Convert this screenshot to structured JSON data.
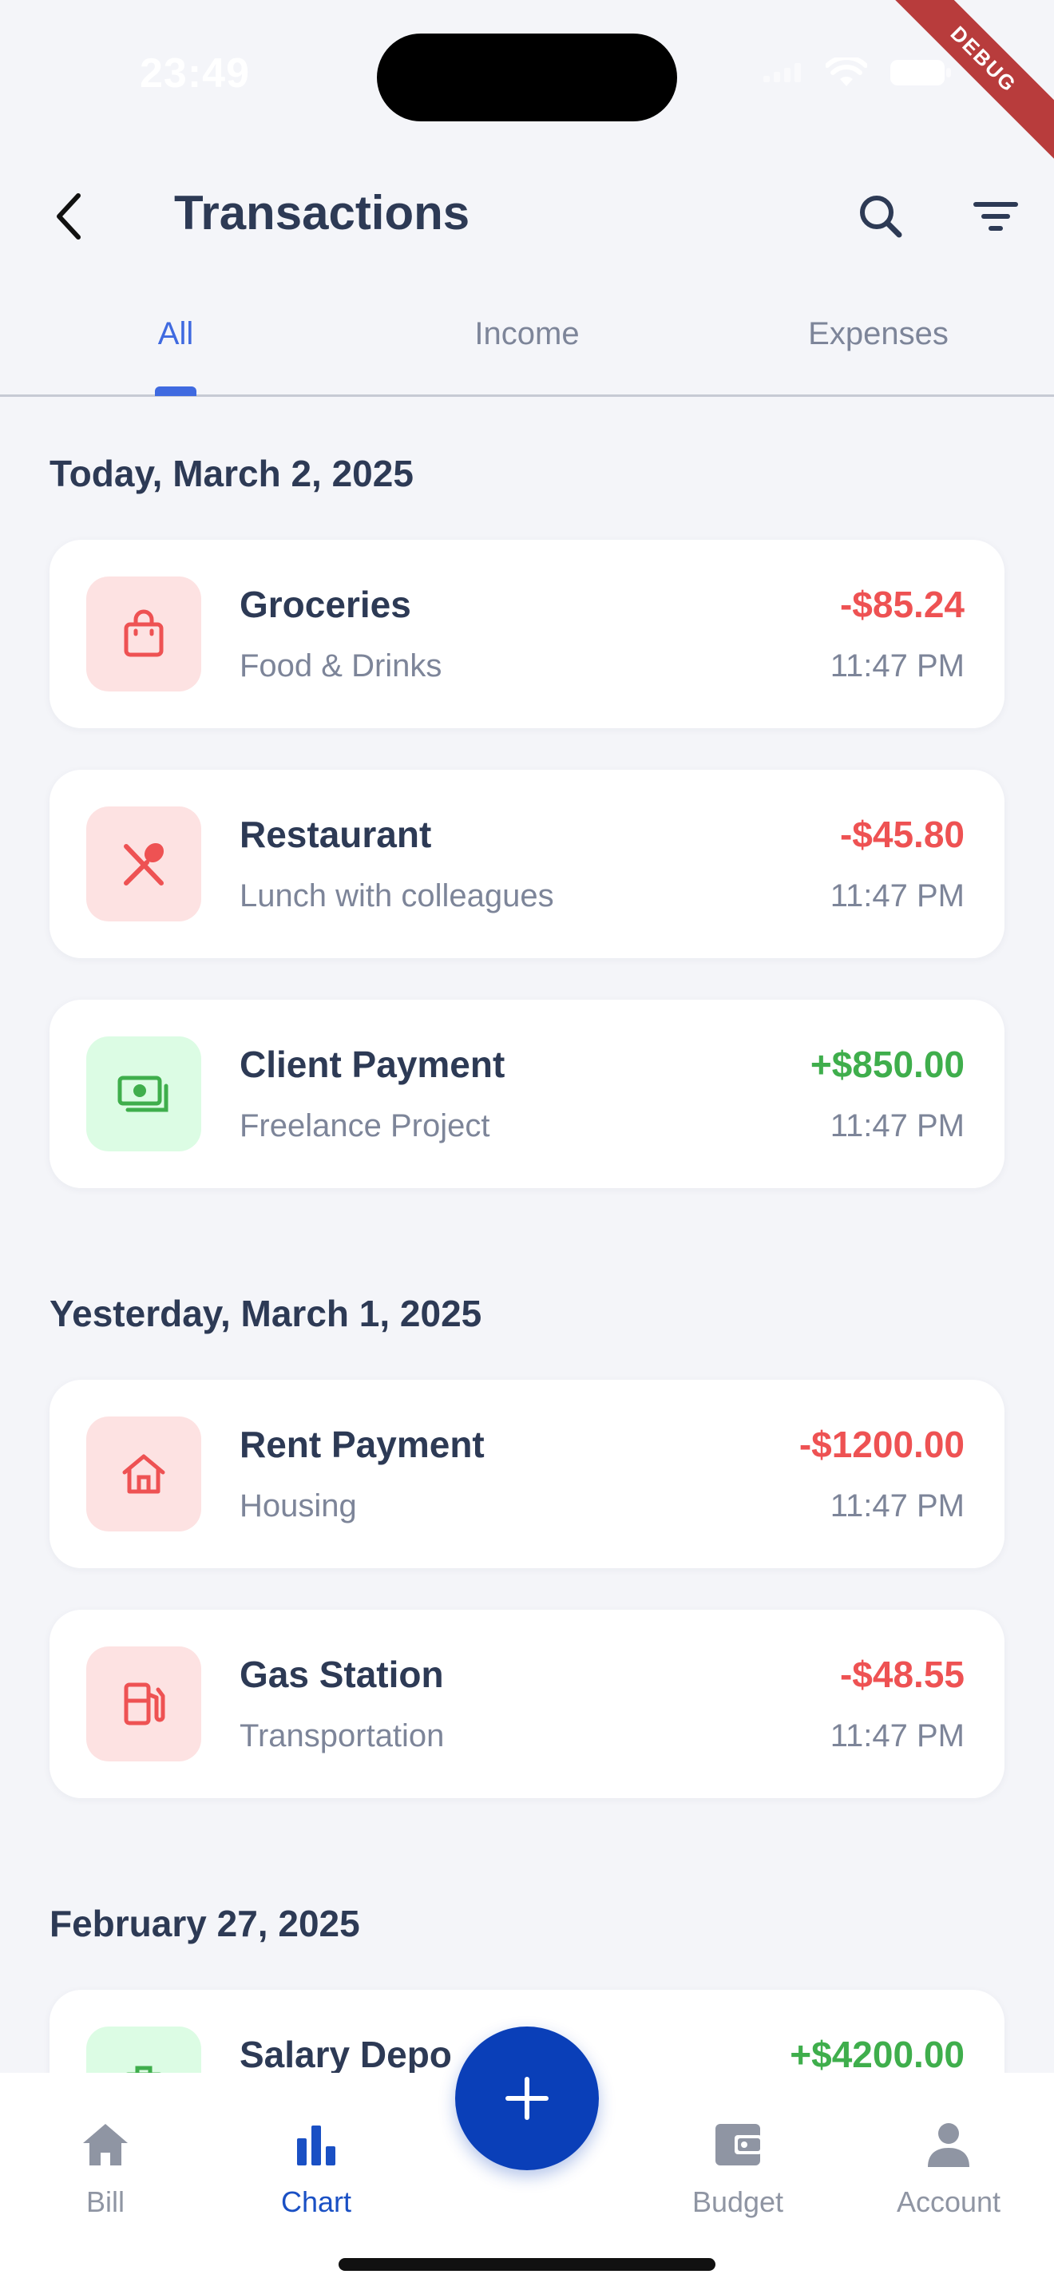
{
  "status_bar": {
    "time": "23:49",
    "debug_label": "DEBUG"
  },
  "header": {
    "title": "Transactions"
  },
  "tabs": [
    {
      "label": "All",
      "active": true
    },
    {
      "label": "Income",
      "active": false
    },
    {
      "label": "Expenses",
      "active": false
    }
  ],
  "sections": [
    {
      "title": "Today, March 2, 2025",
      "transactions": [
        {
          "title": "Groceries",
          "subtitle": "Food & Drinks",
          "amount": "-$85.24",
          "time": "11:47 PM",
          "icon": "shopping-bag-icon",
          "type": "expense"
        },
        {
          "title": "Restaurant",
          "subtitle": "Lunch with colleagues",
          "amount": "-$45.80",
          "time": "11:47 PM",
          "icon": "utensils-icon",
          "type": "expense"
        },
        {
          "title": "Client Payment",
          "subtitle": "Freelance Project",
          "amount": "+$850.00",
          "time": "11:47 PM",
          "icon": "cash-icon",
          "type": "income"
        }
      ]
    },
    {
      "title": "Yesterday, March 1, 2025",
      "transactions": [
        {
          "title": "Rent Payment",
          "subtitle": "Housing",
          "amount": "-$1200.00",
          "time": "11:47 PM",
          "icon": "house-icon",
          "type": "expense"
        },
        {
          "title": "Gas Station",
          "subtitle": "Transportation",
          "amount": "-$48.55",
          "time": "11:47 PM",
          "icon": "gas-pump-icon",
          "type": "expense"
        }
      ]
    },
    {
      "title": "February 27, 2025",
      "transactions": [
        {
          "title": "Salary Depo",
          "amount": "+$4200.00",
          "icon": "briefcase-icon",
          "type": "income"
        }
      ]
    }
  ],
  "bottom_nav": [
    {
      "label": "Bill",
      "icon": "home-icon",
      "active": false
    },
    {
      "label": "Chart",
      "icon": "bar-chart-icon",
      "active": true
    },
    {
      "label": "Budget",
      "icon": "wallet-icon",
      "active": false
    },
    {
      "label": "Account",
      "icon": "person-icon",
      "active": false
    }
  ],
  "colors": {
    "accent": "#3f6ae0",
    "fab": "#0a3fb8",
    "expense": "#ee5253",
    "income": "#3fae4c",
    "background": "#f4f5f9"
  }
}
